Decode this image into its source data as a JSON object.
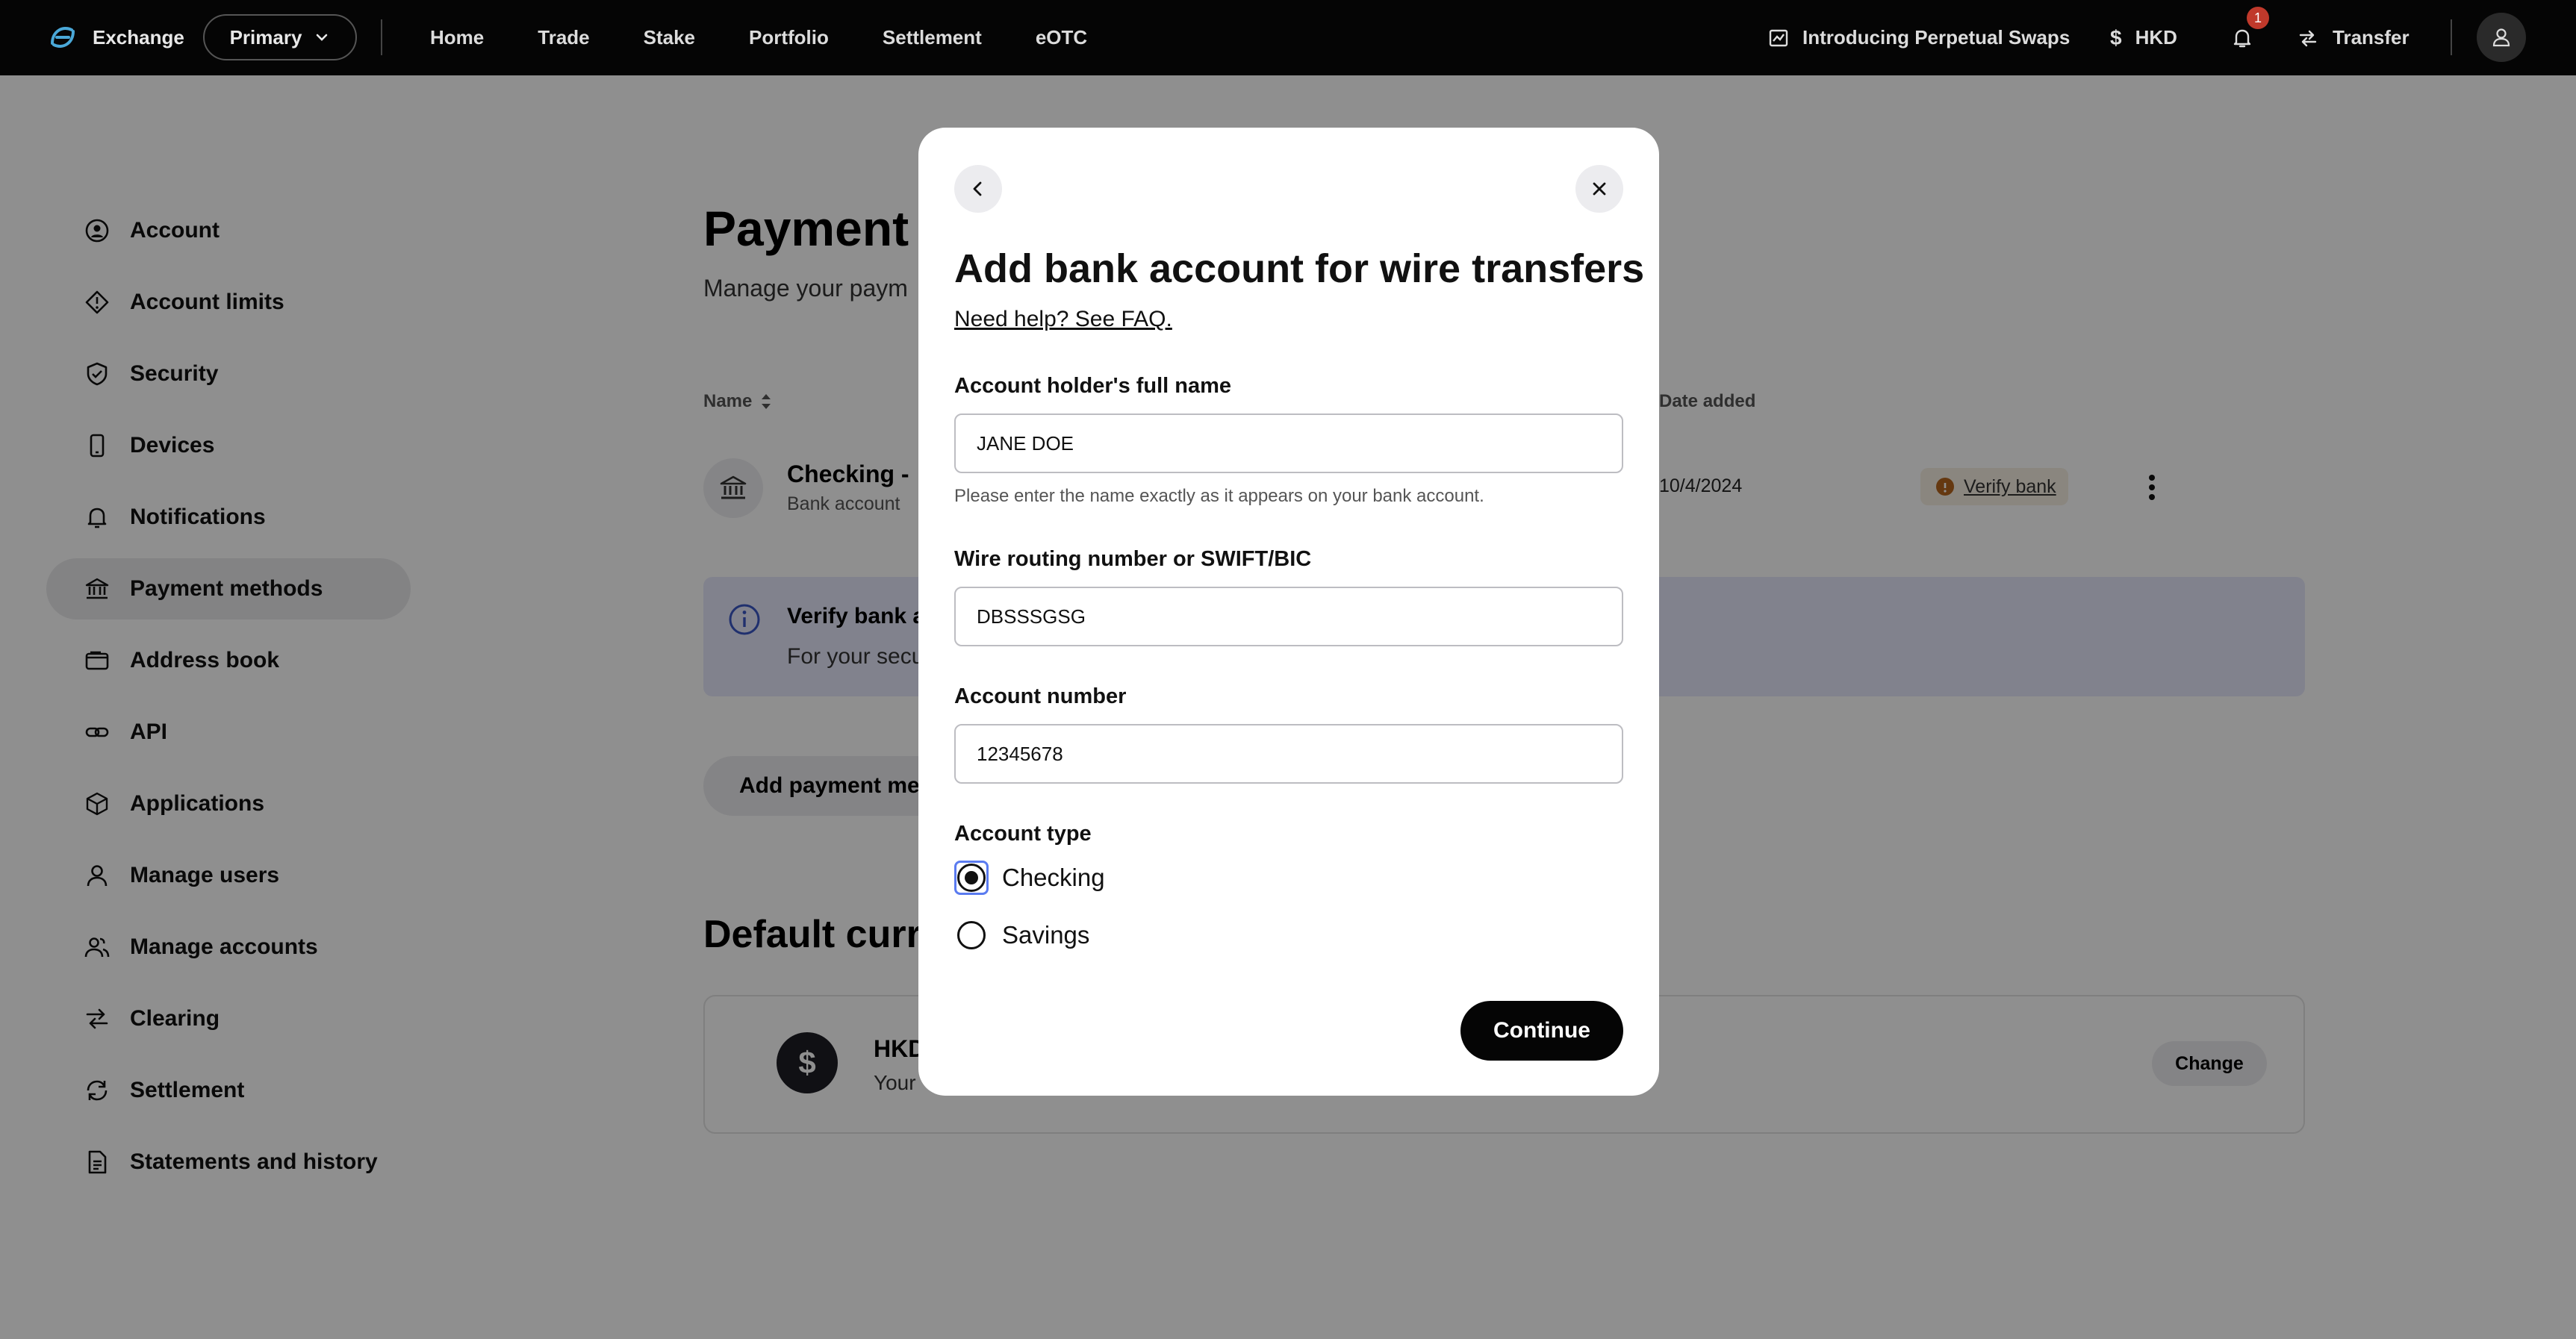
{
  "topnav": {
    "brand": "Exchange",
    "account_switch": "Primary",
    "links": [
      "Home",
      "Trade",
      "Stake",
      "Portfolio",
      "Settlement",
      "eOTC"
    ],
    "promo": "Introducing Perpetual Swaps",
    "currency": "HKD",
    "notification_count": "1",
    "transfer": "Transfer"
  },
  "sidebar": {
    "items": [
      {
        "label": "Account",
        "icon": "user-circle-icon"
      },
      {
        "label": "Account limits",
        "icon": "limits-icon"
      },
      {
        "label": "Security",
        "icon": "shield-icon"
      },
      {
        "label": "Devices",
        "icon": "device-icon"
      },
      {
        "label": "Notifications",
        "icon": "bell-icon"
      },
      {
        "label": "Payment methods",
        "icon": "bank-icon"
      },
      {
        "label": "Address book",
        "icon": "wallet-icon"
      },
      {
        "label": "API",
        "icon": "link-icon"
      },
      {
        "label": "Applications",
        "icon": "cube-icon"
      },
      {
        "label": "Manage users",
        "icon": "user-icon"
      },
      {
        "label": "Manage accounts",
        "icon": "users-icon"
      },
      {
        "label": "Clearing",
        "icon": "swap-icon"
      },
      {
        "label": "Settlement",
        "icon": "refresh-icon"
      },
      {
        "label": "Statements and history",
        "icon": "document-icon"
      }
    ],
    "active_index": 5
  },
  "main": {
    "title": "Payment",
    "subtitle": "Manage your paym",
    "col_name": "Name",
    "col_date": "Date added",
    "row": {
      "name": "Checking -",
      "type": "Bank account",
      "date": "10/4/2024",
      "status": "Verify bank"
    },
    "banner": {
      "title": "Verify bank a",
      "text": "For your secu"
    },
    "add_button": "Add payment met",
    "default_title": "Default curre",
    "currency_card": {
      "symbol": "$",
      "name": "HKD",
      "sub": "Your",
      "change": "Change"
    }
  },
  "modal": {
    "title": "Add bank account for wire transfers",
    "help_link": "Need help? See FAQ.",
    "holder_label": "Account holder's full name",
    "holder_value": "JANE DOE",
    "holder_hint": "Please enter the name exactly as it appears on your bank account.",
    "routing_label": "Wire routing number or SWIFT/BIC",
    "routing_value": "DBSSSGSG",
    "number_label": "Account number",
    "number_value": "12345678",
    "type_label": "Account type",
    "type_options": [
      "Checking",
      "Savings"
    ],
    "selected_type": "Checking",
    "continue": "Continue"
  },
  "colors": {
    "nav_bg": "#050505",
    "brand_accent": "#4aa8d8",
    "banner_bg": "#e6e8fb",
    "verify_dot": "#b5651d",
    "badge": "#c0392b",
    "focus_ring": "#5a7bf0"
  }
}
